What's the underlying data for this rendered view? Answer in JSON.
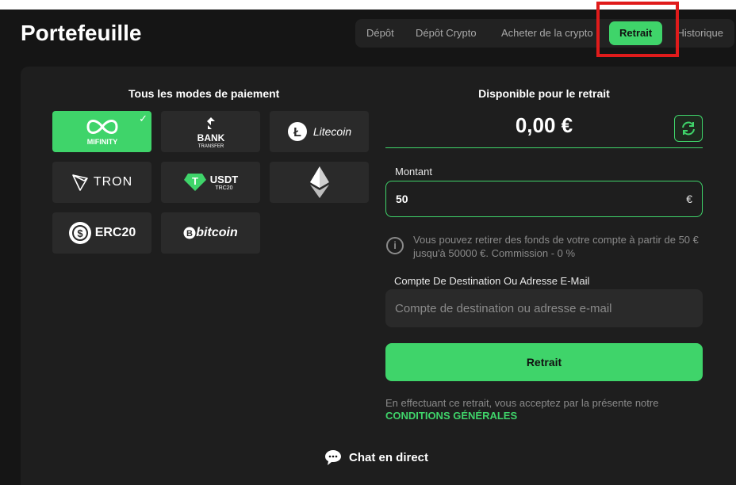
{
  "header": {
    "title": "Portefeuille",
    "tabs": [
      {
        "label": "Dépôt",
        "active": false
      },
      {
        "label": "Dépôt Crypto",
        "active": false
      },
      {
        "label": "Acheter de la crypto",
        "active": false
      },
      {
        "label": "Retrait",
        "active": true
      },
      {
        "label": "Historique",
        "active": false
      }
    ]
  },
  "payment_methods": {
    "title": "Tous les modes de paiement",
    "items": [
      {
        "name": "MIFINITY",
        "selected": true,
        "icon": "mifinity-logo"
      },
      {
        "name": "BANK",
        "sub": "TRANSFER",
        "selected": false,
        "icon": "bank-transfer-logo"
      },
      {
        "name": "Litecoin",
        "selected": false,
        "icon": "litecoin-logo"
      },
      {
        "name": "TRON",
        "selected": false,
        "icon": "tron-logo"
      },
      {
        "name": "USDT",
        "sub": "TRC20",
        "selected": false,
        "icon": "usdt-trc20-logo"
      },
      {
        "name": "",
        "selected": false,
        "icon": "ethereum-logo"
      },
      {
        "name": "ERC20",
        "selected": false,
        "icon": "erc20-logo"
      },
      {
        "name": "bitcoin",
        "selected": false,
        "icon": "bitcoin-logo"
      }
    ]
  },
  "withdraw": {
    "available_title": "Disponible pour le retrait",
    "balance": "0,00 €",
    "amount_label": "Montant",
    "amount_value": "50",
    "currency_symbol": "€",
    "info_text": "Vous pouvez retirer des fonds de votre compte à partir de 50 € jusqu'à 50000 €. Commission - 0 %",
    "destination_label": "Compte De Destination Ou Adresse E-Mail",
    "destination_placeholder": "Compte de destination ou adresse e-mail",
    "submit_label": "Retrait",
    "terms_text": "En effectuant ce retrait, vous acceptez par la présente notre",
    "terms_link": "CONDITIONS GÉNÉRALES"
  },
  "chat": {
    "label": "Chat en direct"
  },
  "colors": {
    "accent": "#3fd46a",
    "highlight": "#e01b1b",
    "background": "#151515",
    "panel": "#1e1e1e"
  }
}
